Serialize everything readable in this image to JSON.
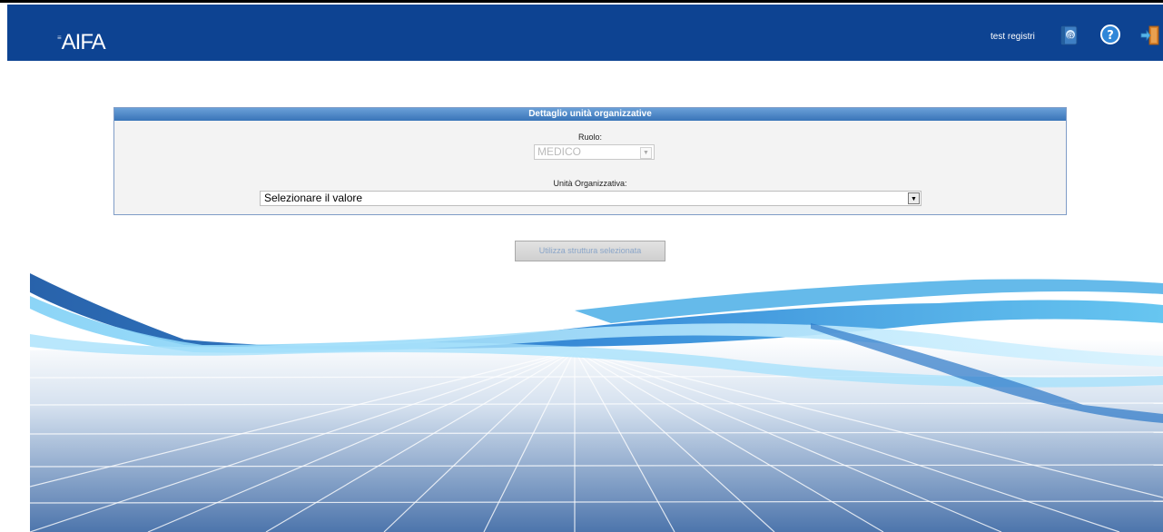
{
  "header": {
    "logo_text": "AIFA",
    "username": "test registri",
    "icons": [
      "address-book-icon",
      "help-icon",
      "logout-icon"
    ]
  },
  "panel": {
    "title": "Dettaglio unità organizzative",
    "ruolo_label": "Ruolo:",
    "ruolo_value": "MEDICO",
    "unita_label": "Unità Organizzativa:",
    "unita_value": "Selezionare il valore"
  },
  "action": {
    "button_label": "Utilizza struttura selezionata"
  },
  "colors": {
    "header_bg": "#0d4392",
    "panel_title_bg": "#3974b8",
    "panel_bg": "#f3f3f3"
  }
}
